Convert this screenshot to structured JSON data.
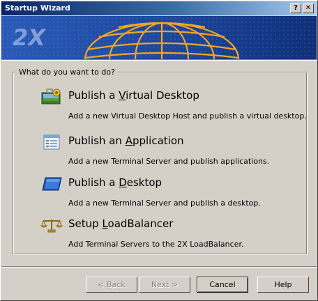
{
  "window": {
    "title": "Startup Wizard",
    "help_button": "?",
    "close_button": "✕"
  },
  "banner": {
    "logo_text": "2X"
  },
  "group": {
    "label": "What do you want to do?"
  },
  "options": [
    {
      "pre": "Publish a ",
      "key": "V",
      "post": "irtual Desktop",
      "description": "Add a new Virtual Desktop Host and publish a virtual desktop.",
      "icon": "virtual-desktop-icon"
    },
    {
      "pre": "Publish an ",
      "key": "A",
      "post": "pplication",
      "description": "Add a new Terminal Server and publish applications.",
      "icon": "application-icon"
    },
    {
      "pre": "Publish a ",
      "key": "D",
      "post": "esktop",
      "description": "Add a new Terminal Server and publish a desktop.",
      "icon": "desktop-icon"
    },
    {
      "pre": "Setup ",
      "key": "L",
      "post": "oadBalancer",
      "description": "Add Terminal Servers to the 2X LoadBalancer.",
      "icon": "load-balancer-icon"
    }
  ],
  "buttons": {
    "back_pre": "< ",
    "back_key": "B",
    "back_post": "ack",
    "next": "Next >",
    "cancel": "Cancel",
    "help": "Help"
  },
  "colors": {
    "title_bar_start": "#0a246a",
    "title_bar_end": "#a6caf0",
    "banner_blue": "#1b4497",
    "globe_orange": "#f5a623",
    "face": "#d4d0c8"
  }
}
